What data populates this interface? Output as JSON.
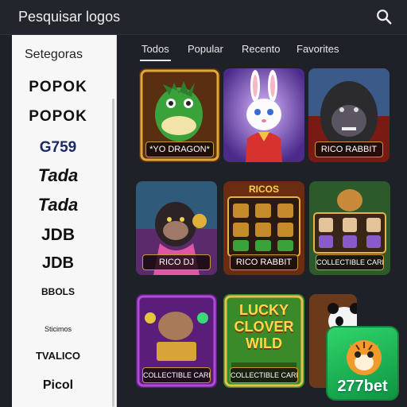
{
  "header": {
    "title": "Pesquisar logos",
    "search_icon": "search-icon"
  },
  "sidebar": {
    "heading": "Setegoras",
    "providers": [
      "POPOK",
      "POPOK",
      "G759",
      "Tada",
      "Tada",
      "JDB",
      "JDB",
      "BBOLS",
      "Sticimos",
      "TVALICO",
      "Picol"
    ]
  },
  "tabs": [
    {
      "label": "Todos",
      "active": true
    },
    {
      "label": "Popular",
      "active": false
    },
    {
      "label": "Recento",
      "active": false
    },
    {
      "label": "Favorites",
      "active": false
    }
  ],
  "games": [
    {
      "label": "*YO DRAGON*",
      "theme": "dragon"
    },
    {
      "label": "",
      "theme": "rabbit"
    },
    {
      "label": "RICO RABBIT",
      "theme": "gorilla"
    },
    {
      "label": "RICO DJ",
      "theme": "monkey"
    },
    {
      "label": "RICO RABBIT",
      "theme": "slots",
      "art_text": "RICOS"
    },
    {
      "label": "COLLECTIBLE CARDS",
      "theme": "slots2"
    },
    {
      "label": "COLLECTIBLE CARDS",
      "theme": "treasure"
    },
    {
      "label": "COLLECTIBLE CARDS",
      "theme": "clover",
      "art_text": [
        "LUCKY",
        "CLOVER",
        "WILD"
      ]
    },
    {
      "label": "",
      "theme": "panda"
    }
  ],
  "brand": {
    "name": "277bet"
  },
  "colors": {
    "accent": "#c9973a",
    "brand_green": "#1fbf57"
  }
}
